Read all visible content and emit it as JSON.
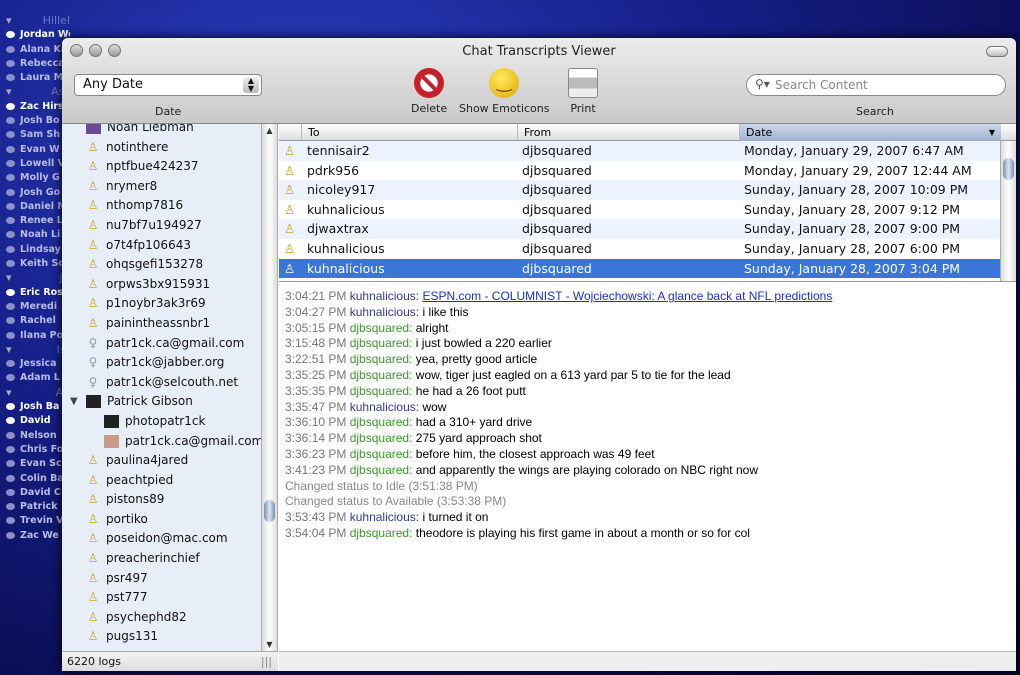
{
  "background_list": [
    {
      "type": "header",
      "label": "Hillel"
    },
    {
      "label": "Jordan Weiss",
      "bold": true
    },
    {
      "label": "Alana Kahn"
    },
    {
      "label": "Rebecca"
    },
    {
      "label": "Laura M"
    },
    {
      "type": "header",
      "label": "Ass"
    },
    {
      "label": "Zac Hirsc",
      "bold": true
    },
    {
      "label": "Josh Bo"
    },
    {
      "label": "Sam Sh"
    },
    {
      "label": "Evan W"
    },
    {
      "label": "Lowell V"
    },
    {
      "label": "Molly G"
    },
    {
      "label": "Josh Go"
    },
    {
      "label": "Daniel N"
    },
    {
      "label": "Renee L"
    },
    {
      "label": "Noah Li"
    },
    {
      "label": "Lindsay"
    },
    {
      "label": "Keith Sc"
    },
    {
      "type": "header",
      "label": "JA"
    },
    {
      "label": "Eric Ros",
      "bold": true
    },
    {
      "label": "Meredi"
    },
    {
      "label": "Rachel"
    },
    {
      "label": "Ilana Po"
    },
    {
      "type": "header",
      "label": "Isr"
    },
    {
      "label": "Jessica"
    },
    {
      "label": "Adam L"
    },
    {
      "type": "header",
      "label": "Ad"
    },
    {
      "label": "Josh Ba",
      "bold": true
    },
    {
      "label": "David",
      "bold": true
    },
    {
      "label": "Nelson"
    },
    {
      "label": "Chris Fo"
    },
    {
      "label": "Evan Sc"
    },
    {
      "label": "Colin Ba"
    },
    {
      "label": "David C"
    },
    {
      "label": "Patrick"
    },
    {
      "label": "Trevin V"
    },
    {
      "label": "Zac We"
    }
  ],
  "window": {
    "title": "Chat Transcripts Viewer"
  },
  "toolbar": {
    "date_value": "Any Date",
    "date_label": "Date",
    "delete": "Delete",
    "emoticons": "Show Emoticons",
    "print": "Print",
    "search_placeholder": "Search Content",
    "search_label": "Search"
  },
  "contacts": [
    {
      "name": "Noah Liebman",
      "icon": "image"
    },
    {
      "name": "notinthere",
      "icon": "aim"
    },
    {
      "name": "nptfbue424237",
      "icon": "aim"
    },
    {
      "name": "nrymer8",
      "icon": "aim"
    },
    {
      "name": "nthomp7816",
      "icon": "aim"
    },
    {
      "name": "nu7bf7u194927",
      "icon": "aim"
    },
    {
      "name": "o7t4fp106643",
      "icon": "aim"
    },
    {
      "name": "ohqsgefi153278",
      "icon": "aim"
    },
    {
      "name": "orpws3bx915931",
      "icon": "aim"
    },
    {
      "name": "p1noybr3ak3r69",
      "icon": "aim"
    },
    {
      "name": "painintheassnbr1",
      "icon": "aim"
    },
    {
      "name": "patr1ck.ca@gmail.com",
      "icon": "jabber"
    },
    {
      "name": "patr1ck@jabber.org",
      "icon": "jabber"
    },
    {
      "name": "patr1ck@selcouth.net",
      "icon": "jabber"
    },
    {
      "name": "Patrick Gibson",
      "icon": "image",
      "expanded": true
    },
    {
      "name": "photopatr1ck",
      "icon": "image",
      "sub": true
    },
    {
      "name": "patr1ck.ca@gmail.com",
      "icon": "gmail",
      "sub": true
    },
    {
      "name": "paulina4jared",
      "icon": "aim"
    },
    {
      "name": "peachtpied",
      "icon": "aim"
    },
    {
      "name": "pistons89",
      "icon": "aim"
    },
    {
      "name": "portiko",
      "icon": "aim"
    },
    {
      "name": "poseidon@mac.com",
      "icon": "aim"
    },
    {
      "name": "preacherinchief",
      "icon": "aim"
    },
    {
      "name": "psr497",
      "icon": "aim"
    },
    {
      "name": "pst777",
      "icon": "aim"
    },
    {
      "name": "psychephd82",
      "icon": "aim"
    },
    {
      "name": "pugs131",
      "icon": "aim"
    }
  ],
  "status": {
    "log_count": "6220 logs"
  },
  "table": {
    "columns": [
      "To",
      "From",
      "Date"
    ],
    "sorted_column": "Date",
    "rows": [
      {
        "to": "tennisair2",
        "from": "djbsquared",
        "date": "Monday, January 29, 2007 6:47 AM"
      },
      {
        "to": "pdrk956",
        "from": "djbsquared",
        "date": "Monday, January 29, 2007 12:44 AM"
      },
      {
        "to": "nicoley917",
        "from": "djbsquared",
        "date": "Sunday, January 28, 2007 10:09 PM"
      },
      {
        "to": "kuhnalicious",
        "from": "djbsquared",
        "date": "Sunday, January 28, 2007 9:12 PM"
      },
      {
        "to": "djwaxtrax",
        "from": "djbsquared",
        "date": "Sunday, January 28, 2007 9:00 PM"
      },
      {
        "to": "kuhnalicious",
        "from": "djbsquared",
        "date": "Sunday, January 28, 2007 6:00 PM"
      },
      {
        "to": "kuhnalicious",
        "from": "djbsquared",
        "date": "Sunday, January 28, 2007 3:04 PM",
        "selected": true
      }
    ]
  },
  "transcript": [
    {
      "time": "3:04:21 PM",
      "user": "kuhnalicious:",
      "who": 1,
      "link": "ESPN.com - COLUMNIST - Wojciechowski: A glance back at NFL predictions"
    },
    {
      "time": "3:04:27 PM",
      "user": "kuhnalicious:",
      "who": 1,
      "text": "i like this"
    },
    {
      "time": "3:05:15 PM",
      "user": "djbsquared:",
      "who": 2,
      "text": "alright"
    },
    {
      "time": "3:15:48 PM",
      "user": "djbsquared:",
      "who": 2,
      "text": "i just bowled a 220 earlier"
    },
    {
      "time": "3:22:51 PM",
      "user": "djbsquared:",
      "who": 2,
      "text": "yea, pretty good article"
    },
    {
      "time": "3:35:25 PM",
      "user": "djbsquared:",
      "who": 2,
      "text": "wow, tiger just eagled on a 613 yard par 5 to tie for the lead"
    },
    {
      "time": "3:35:35 PM",
      "user": "djbsquared:",
      "who": 2,
      "text": "he had a 26 foot putt"
    },
    {
      "time": "3:35:47 PM",
      "user": "kuhnalicious:",
      "who": 1,
      "text": "wow"
    },
    {
      "time": "3:36:10 PM",
      "user": "djbsquared:",
      "who": 2,
      "text": "had a 310+ yard drive"
    },
    {
      "time": "3:36:14 PM",
      "user": "djbsquared:",
      "who": 2,
      "text": "275 yard approach shot"
    },
    {
      "time": "3:36:23 PM",
      "user": "djbsquared:",
      "who": 2,
      "text": "before him, the closest approach was 49 feet"
    },
    {
      "time": "3:41:23 PM",
      "user": "djbsquared:",
      "who": 2,
      "text": "and apparently the wings are playing colorado on NBC right now"
    },
    {
      "system": "Changed status to Idle (3:51:38 PM)"
    },
    {
      "system": "Changed status to Available (3:53:38 PM)"
    },
    {
      "time": "3:53:43 PM",
      "user": "kuhnalicious:",
      "who": 1,
      "text": "i turned it on"
    },
    {
      "time": "3:54:04 PM",
      "user": "djbsquared:",
      "who": 2,
      "text": "theodore is playing his first game in about a month or so for col"
    }
  ],
  "colors": {
    "selection": "#3a76d8",
    "user1": "#2f3aa0",
    "user2": "#3a9a2a",
    "link": "#1a2fd0"
  }
}
